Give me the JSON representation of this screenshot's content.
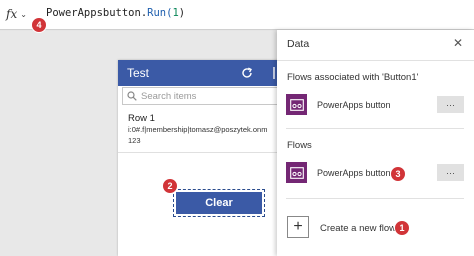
{
  "formula_bar": {
    "fx_label": "fx",
    "formula_prefix": "PowerAppsbutton.",
    "formula_fn": "Run(",
    "formula_arg": "1",
    "formula_suffix": ")"
  },
  "app": {
    "title": "Test",
    "search_placeholder": "Search items",
    "gallery": [
      {
        "title": "Row 1",
        "subtitle": "i:0#.f|membership|tomasz@poszytek.onm",
        "value": "123"
      }
    ],
    "clear_label": "Clear"
  },
  "data_panel": {
    "title": "Data",
    "associated_label": "Flows associated with 'Button1'",
    "associated_flow": "PowerApps button",
    "flows_label": "Flows",
    "flow": "PowerApps button",
    "more_label": "···",
    "create_label": "Create a new flow",
    "create_plus": "+",
    "close_glyph": "✕"
  },
  "badges": [
    "4",
    "2",
    "3",
    "1"
  ],
  "colors": {
    "header": "#3b5aa6",
    "flow_icon": "#742774",
    "badge": "#d13438"
  }
}
